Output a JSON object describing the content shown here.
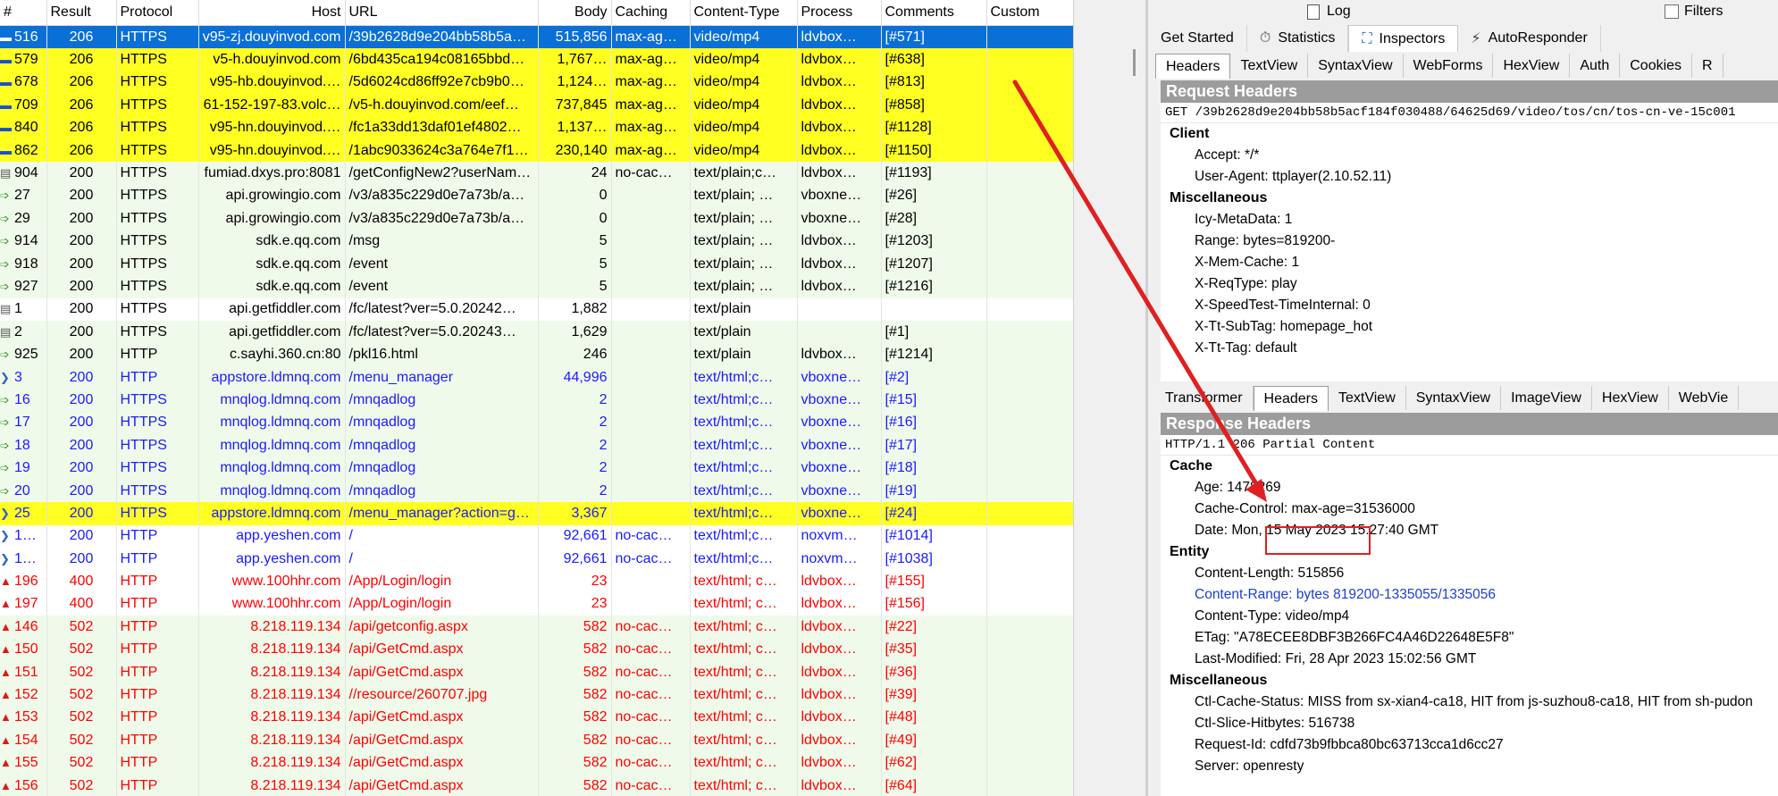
{
  "columns": [
    "#",
    "Result",
    "Protocol",
    "Host",
    "URL",
    "Body",
    "Caching",
    "Content-Type",
    "Process",
    "Comments",
    "Custom"
  ],
  "colors": {
    "selected_bg": "#0a6fd6",
    "yellow_bg": "#ffff21",
    "green_bg": "#f0faea",
    "blue_text": "#1a1aff",
    "red_text": "#ff0000",
    "arrow": "#e02020"
  },
  "rows": [
    {
      "id": "516",
      "result": "206",
      "protocol": "HTTPS",
      "host": "v95-zj.douyinvod.com",
      "url": "/39b2628d9e204bb58b5a…",
      "body": "515,856",
      "caching": "max-ag…",
      "ctype": "video/mp4",
      "process": "ldvbox…",
      "comments": "[#571]",
      "bg": "selected",
      "fg": "white",
      "icon": "video-icon"
    },
    {
      "id": "579",
      "result": "206",
      "protocol": "HTTPS",
      "host": "v5-h.douyinvod.com",
      "url": "/6bd435ca194c08165bbd…",
      "body": "1,767…",
      "caching": "max-ag…",
      "ctype": "video/mp4",
      "process": "ldvbox…",
      "comments": "[#638]",
      "bg": "yellow",
      "fg": "black",
      "icon": "video-icon"
    },
    {
      "id": "678",
      "result": "206",
      "protocol": "HTTPS",
      "host": "v95-hb.douyinvod.…",
      "url": "/5d6024cd86ff92e7cb9b0…",
      "body": "1,124…",
      "caching": "max-ag…",
      "ctype": "video/mp4",
      "process": "ldvbox…",
      "comments": "[#813]",
      "bg": "yellow",
      "fg": "black",
      "icon": "video-icon"
    },
    {
      "id": "709",
      "result": "206",
      "protocol": "HTTPS",
      "host": "61-152-197-83.volc…",
      "url": "/v5-h.douyinvod.com/eef…",
      "body": "737,845",
      "caching": "max-ag…",
      "ctype": "video/mp4",
      "process": "ldvbox…",
      "comments": "[#858]",
      "bg": "yellow",
      "fg": "black",
      "icon": "video-icon"
    },
    {
      "id": "840",
      "result": "206",
      "protocol": "HTTPS",
      "host": "v95-hn.douyinvod.…",
      "url": "/fc1a33dd13daf01ef4802…",
      "body": "1,137…",
      "caching": "max-ag…",
      "ctype": "video/mp4",
      "process": "ldvbox…",
      "comments": "[#1128]",
      "bg": "yellow",
      "fg": "black",
      "icon": "video-icon"
    },
    {
      "id": "862",
      "result": "206",
      "protocol": "HTTPS",
      "host": "v95-hn.douyinvod.…",
      "url": "/1abc9033624c3a764e7f1…",
      "body": "230,140",
      "caching": "max-ag…",
      "ctype": "video/mp4",
      "process": "ldvbox…",
      "comments": "[#1150]",
      "bg": "yellow",
      "fg": "black",
      "icon": "video-icon"
    },
    {
      "id": "904",
      "result": "200",
      "protocol": "HTTPS",
      "host": "fumiad.dxys.pro:8081",
      "url": "/getConfigNew2?userNam…",
      "body": "24",
      "caching": "no-cac…",
      "ctype": "text/plain;c…",
      "process": "ldvbox…",
      "comments": "[#1193]",
      "bg": "green",
      "fg": "black",
      "icon": "doc-icon"
    },
    {
      "id": "27",
      "result": "200",
      "protocol": "HTTPS",
      "host": "api.growingio.com",
      "url": "/v3/a835c229d0e7a73b/a…",
      "body": "0",
      "caching": "",
      "ctype": "text/plain; …",
      "process": "vboxne…",
      "comments": "[#26]",
      "bg": "green",
      "fg": "black",
      "icon": "post-arrow-icon"
    },
    {
      "id": "29",
      "result": "200",
      "protocol": "HTTPS",
      "host": "api.growingio.com",
      "url": "/v3/a835c229d0e7a73b/a…",
      "body": "0",
      "caching": "",
      "ctype": "text/plain; …",
      "process": "vboxne…",
      "comments": "[#28]",
      "bg": "green",
      "fg": "black",
      "icon": "post-arrow-icon"
    },
    {
      "id": "914",
      "result": "200",
      "protocol": "HTTPS",
      "host": "sdk.e.qq.com",
      "url": "/msg",
      "body": "5",
      "caching": "",
      "ctype": "text/plain; …",
      "process": "ldvbox…",
      "comments": "[#1203]",
      "bg": "green",
      "fg": "black",
      "icon": "post-arrow-icon"
    },
    {
      "id": "918",
      "result": "200",
      "protocol": "HTTPS",
      "host": "sdk.e.qq.com",
      "url": "/event",
      "body": "5",
      "caching": "",
      "ctype": "text/plain; …",
      "process": "ldvbox…",
      "comments": "[#1207]",
      "bg": "green",
      "fg": "black",
      "icon": "post-arrow-icon"
    },
    {
      "id": "927",
      "result": "200",
      "protocol": "HTTPS",
      "host": "sdk.e.qq.com",
      "url": "/event",
      "body": "5",
      "caching": "",
      "ctype": "text/plain; …",
      "process": "ldvbox…",
      "comments": "[#1216]",
      "bg": "green",
      "fg": "black",
      "icon": "post-arrow-icon"
    },
    {
      "id": "1",
      "result": "200",
      "protocol": "HTTPS",
      "host": "api.getfiddler.com",
      "url": "/fc/latest?ver=5.0.20242…",
      "body": "1,882",
      "caching": "",
      "ctype": "text/plain",
      "process": "",
      "comments": "",
      "bg": "white",
      "fg": "black",
      "icon": "doc-icon"
    },
    {
      "id": "2",
      "result": "200",
      "protocol": "HTTPS",
      "host": "api.getfiddler.com",
      "url": "/fc/latest?ver=5.0.20243…",
      "body": "1,629",
      "caching": "",
      "ctype": "text/plain",
      "process": "",
      "comments": "[#1]",
      "bg": "green",
      "fg": "black",
      "icon": "doc-icon"
    },
    {
      "id": "925",
      "result": "200",
      "protocol": "HTTP",
      "host": "c.sayhi.360.cn:80",
      "url": "/pkl16.html",
      "body": "246",
      "caching": "",
      "ctype": "text/plain",
      "process": "ldvbox…",
      "comments": "[#1214]",
      "bg": "green",
      "fg": "black",
      "icon": "post-arrow-icon"
    },
    {
      "id": "3",
      "result": "200",
      "protocol": "HTTP",
      "host": "appstore.ldmnq.com",
      "url": "/menu_manager",
      "body": "44,996",
      "caching": "",
      "ctype": "text/html;c…",
      "process": "vboxne…",
      "comments": "[#2]",
      "bg": "green",
      "fg": "blue",
      "icon": "html-icon"
    },
    {
      "id": "16",
      "result": "200",
      "protocol": "HTTPS",
      "host": "mnqlog.ldmnq.com",
      "url": "/mnqadlog",
      "body": "2",
      "caching": "",
      "ctype": "text/html;c…",
      "process": "vboxne…",
      "comments": "[#15]",
      "bg": "green",
      "fg": "blue",
      "icon": "post-arrow-icon"
    },
    {
      "id": "17",
      "result": "200",
      "protocol": "HTTPS",
      "host": "mnqlog.ldmnq.com",
      "url": "/mnqadlog",
      "body": "2",
      "caching": "",
      "ctype": "text/html;c…",
      "process": "vboxne…",
      "comments": "[#16]",
      "bg": "green",
      "fg": "blue",
      "icon": "post-arrow-icon"
    },
    {
      "id": "18",
      "result": "200",
      "protocol": "HTTPS",
      "host": "mnqlog.ldmnq.com",
      "url": "/mnqadlog",
      "body": "2",
      "caching": "",
      "ctype": "text/html;c…",
      "process": "vboxne…",
      "comments": "[#17]",
      "bg": "green",
      "fg": "blue",
      "icon": "post-arrow-icon"
    },
    {
      "id": "19",
      "result": "200",
      "protocol": "HTTPS",
      "host": "mnqlog.ldmnq.com",
      "url": "/mnqadlog",
      "body": "2",
      "caching": "",
      "ctype": "text/html;c…",
      "process": "vboxne…",
      "comments": "[#18]",
      "bg": "green",
      "fg": "blue",
      "icon": "post-arrow-icon"
    },
    {
      "id": "20",
      "result": "200",
      "protocol": "HTTPS",
      "host": "mnqlog.ldmnq.com",
      "url": "/mnqadlog",
      "body": "2",
      "caching": "",
      "ctype": "text/html;c…",
      "process": "vboxne…",
      "comments": "[#19]",
      "bg": "green",
      "fg": "blue",
      "icon": "post-arrow-icon"
    },
    {
      "id": "25",
      "result": "200",
      "protocol": "HTTPS",
      "host": "appstore.ldmnq.com",
      "url": "/menu_manager?action=g…",
      "body": "3,367",
      "caching": "",
      "ctype": "text/html;c…",
      "process": "vboxne…",
      "comments": "[#24]",
      "bg": "yellow",
      "fg": "blue",
      "icon": "html-icon"
    },
    {
      "id": "1…",
      "result": "200",
      "protocol": "HTTP",
      "host": "app.yeshen.com",
      "url": "/",
      "body": "92,661",
      "caching": "no-cac…",
      "ctype": "text/html;c…",
      "process": "noxvm…",
      "comments": "[#1014]",
      "bg": "white",
      "fg": "blue",
      "icon": "html-icon"
    },
    {
      "id": "1…",
      "result": "200",
      "protocol": "HTTP",
      "host": "app.yeshen.com",
      "url": "/",
      "body": "92,661",
      "caching": "no-cac…",
      "ctype": "text/html;c…",
      "process": "noxvm…",
      "comments": "[#1038]",
      "bg": "white",
      "fg": "blue",
      "icon": "html-icon"
    },
    {
      "id": "196",
      "result": "400",
      "protocol": "HTTP",
      "host": "www.100hhr.com",
      "url": "/App/Login/login",
      "body": "23",
      "caching": "",
      "ctype": "text/html; c…",
      "process": "ldvbox…",
      "comments": "[#155]",
      "bg": "white",
      "fg": "red",
      "icon": "warning-icon"
    },
    {
      "id": "197",
      "result": "400",
      "protocol": "HTTP",
      "host": "www.100hhr.com",
      "url": "/App/Login/login",
      "body": "23",
      "caching": "",
      "ctype": "text/html; c…",
      "process": "ldvbox…",
      "comments": "[#156]",
      "bg": "white",
      "fg": "red",
      "icon": "warning-icon"
    },
    {
      "id": "146",
      "result": "502",
      "protocol": "HTTP",
      "host": "8.218.119.134",
      "url": "/api/getconfig.aspx",
      "body": "582",
      "caching": "no-cac…",
      "ctype": "text/html; c…",
      "process": "ldvbox…",
      "comments": "[#22]",
      "bg": "green",
      "fg": "red",
      "icon": "warning-icon"
    },
    {
      "id": "150",
      "result": "502",
      "protocol": "HTTP",
      "host": "8.218.119.134",
      "url": "/api/GetCmd.aspx",
      "body": "582",
      "caching": "no-cac…",
      "ctype": "text/html; c…",
      "process": "ldvbox…",
      "comments": "[#35]",
      "bg": "green",
      "fg": "red",
      "icon": "warning-icon"
    },
    {
      "id": "151",
      "result": "502",
      "protocol": "HTTP",
      "host": "8.218.119.134",
      "url": "/api/GetCmd.aspx",
      "body": "582",
      "caching": "no-cac…",
      "ctype": "text/html; c…",
      "process": "ldvbox…",
      "comments": "[#36]",
      "bg": "green",
      "fg": "red",
      "icon": "warning-icon"
    },
    {
      "id": "152",
      "result": "502",
      "protocol": "HTTP",
      "host": "8.218.119.134",
      "url": "//resource/260707.jpg",
      "body": "582",
      "caching": "no-cac…",
      "ctype": "text/html; c…",
      "process": "ldvbox…",
      "comments": "[#39]",
      "bg": "green",
      "fg": "red",
      "icon": "warning-icon"
    },
    {
      "id": "153",
      "result": "502",
      "protocol": "HTTP",
      "host": "8.218.119.134",
      "url": "/api/GetCmd.aspx",
      "body": "582",
      "caching": "no-cac…",
      "ctype": "text/html; c…",
      "process": "ldvbox…",
      "comments": "[#48]",
      "bg": "green",
      "fg": "red",
      "icon": "warning-icon"
    },
    {
      "id": "154",
      "result": "502",
      "protocol": "HTTP",
      "host": "8.218.119.134",
      "url": "/api/GetCmd.aspx",
      "body": "582",
      "caching": "no-cac…",
      "ctype": "text/html; c…",
      "process": "ldvbox…",
      "comments": "[#49]",
      "bg": "green",
      "fg": "red",
      "icon": "warning-icon"
    },
    {
      "id": "155",
      "result": "502",
      "protocol": "HTTP",
      "host": "8.218.119.134",
      "url": "/api/GetCmd.aspx",
      "body": "582",
      "caching": "no-cac…",
      "ctype": "text/html; c…",
      "process": "ldvbox…",
      "comments": "[#62]",
      "bg": "green",
      "fg": "red",
      "icon": "warning-icon"
    },
    {
      "id": "156",
      "result": "502",
      "protocol": "HTTP",
      "host": "8.218.119.134",
      "url": "/api/GetCmd.aspx",
      "body": "582",
      "caching": "no-cac…",
      "ctype": "text/html; c…",
      "process": "ldvbox…",
      "comments": "[#64]",
      "bg": "green",
      "fg": "red",
      "icon": "warning-icon"
    }
  ],
  "inspector": {
    "toolbar": {
      "log": "Log",
      "filters": "Filters"
    },
    "tabs": [
      {
        "label": "Get Started",
        "icon": ""
      },
      {
        "label": "Statistics",
        "icon": "stopwatch-icon"
      },
      {
        "label": "Inspectors",
        "icon": "inspector-icon",
        "active": true
      },
      {
        "label": "AutoResponder",
        "icon": "lightning-icon"
      }
    ],
    "request_tabs": [
      "Headers",
      "TextView",
      "SyntaxView",
      "WebForms",
      "HexView",
      "Auth",
      "Cookies",
      "R"
    ],
    "request_active": "Headers",
    "request": {
      "title": "Request Headers",
      "first_line": "GET /39b2628d9e204bb58b5acf184f030488/64625d69/video/tos/cn/tos-cn-ve-15c001",
      "groups": [
        {
          "name": "Client",
          "lines": [
            "Accept: */*",
            "User-Agent: ttplayer(2.10.52.11)"
          ]
        },
        {
          "name": "Miscellaneous",
          "lines": [
            "Icy-MetaData: 1",
            "Range: bytes=819200-",
            "X-Mem-Cache: 1",
            "X-ReqType: play",
            "X-SpeedTest-TimeInternal: 0",
            "X-Tt-SubTag: homepage_hot",
            "X-Tt-Tag: default"
          ]
        }
      ]
    },
    "response_tabs": [
      "Transformer",
      "Headers",
      "TextView",
      "SyntaxView",
      "ImageView",
      "HexView",
      "WebVie"
    ],
    "response_active": "Headers",
    "response": {
      "title": "Response Headers",
      "first_line": "HTTP/1.1 206 Partial Content",
      "groups": [
        {
          "name": "Cache",
          "lines": [
            "Age: 1478269",
            "Cache-Control: max-age=31536000",
            "Date: Mon, 15 May 2023 15:27:40 GMT"
          ]
        },
        {
          "name": "Entity",
          "lines": [
            "Content-Length: 515856",
            "Content-Range: bytes 819200-1335055/1335056",
            "Content-Type: video/mp4",
            "ETag: \"A78ECEE8DBF3B266FC4A46D22648E5F8\"",
            "Last-Modified: Fri, 28 Apr 2023 15:02:56 GMT"
          ]
        },
        {
          "name": "Miscellaneous",
          "lines": [
            "Ctl-Cache-Status: MISS from sx-xian4-ca18, HIT from js-suzhou8-ca18, HIT from sh-pudon",
            "Ctl-Slice-Hitbytes: 516738",
            "Request-Id: cdfd73b9fbbca80bc63713cca1d6cc27",
            "Server: openresty"
          ]
        }
      ]
    }
  }
}
